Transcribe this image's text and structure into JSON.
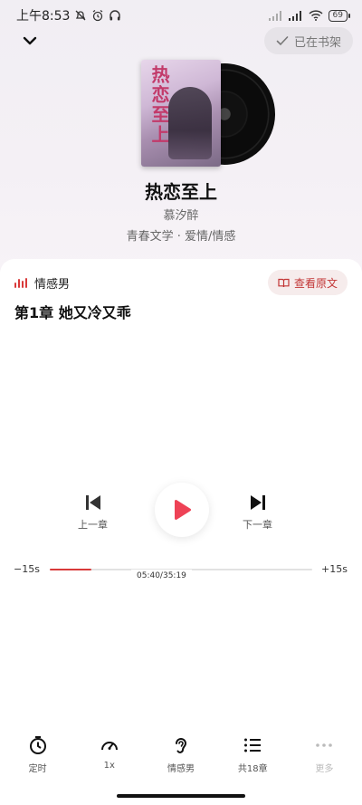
{
  "status": {
    "time": "上午8:53",
    "battery": "69"
  },
  "header": {
    "shelf_label": "已在书架"
  },
  "book": {
    "title": "热恋至上",
    "author": "慕汐醉",
    "tags": "青春文学 · 爱情/情感",
    "cover_text": "热恋至上"
  },
  "player": {
    "voice": "情感男",
    "view_original": "查看原文",
    "chapter_title": "第1章 她又冷又乖",
    "prev_label": "上一章",
    "next_label": "下一章",
    "skip_back": "−15s",
    "skip_forward": "+15s",
    "time_display": "05:40/35:19",
    "progress_fraction": 0.16
  },
  "bottom_nav": {
    "timer": "定时",
    "speed": "1x",
    "voice": "情感男",
    "chapters": "共18章",
    "more": "更多"
  },
  "colors": {
    "accent": "#d93a3a",
    "play": "#ee4256"
  }
}
